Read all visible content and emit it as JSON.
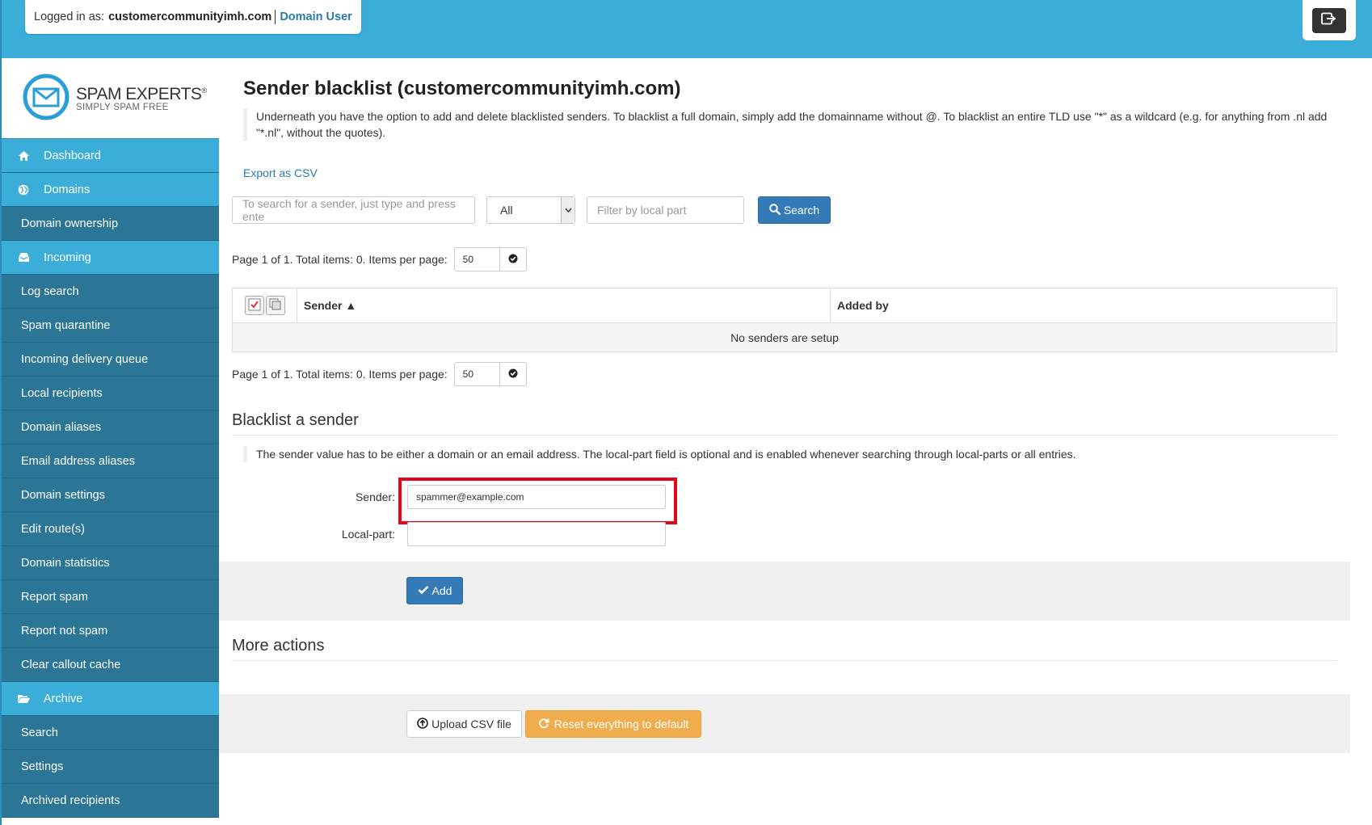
{
  "header": {
    "logged_in_label": "Logged in as:",
    "domain": "customercommunityimh.com",
    "role": "Domain User",
    "logout_icon": "logout-icon"
  },
  "brand": {
    "name": "SPAM EXPERTS",
    "registered": "®",
    "tagline": "SIMPLY SPAM FREE"
  },
  "sidebar": {
    "items": [
      {
        "label": "Dashboard",
        "type": "main",
        "icon": "home-icon"
      },
      {
        "label": "Domains",
        "type": "main",
        "icon": "globe-icon"
      },
      {
        "label": "Domain ownership",
        "type": "sub"
      },
      {
        "label": "Incoming",
        "type": "main",
        "icon": "inbox-icon"
      },
      {
        "label": "Log search",
        "type": "sub"
      },
      {
        "label": "Spam quarantine",
        "type": "sub"
      },
      {
        "label": "Incoming delivery queue",
        "type": "sub"
      },
      {
        "label": "Local recipients",
        "type": "sub"
      },
      {
        "label": "Domain aliases",
        "type": "sub"
      },
      {
        "label": "Email address aliases",
        "type": "sub"
      },
      {
        "label": "Domain settings",
        "type": "sub"
      },
      {
        "label": "Edit route(s)",
        "type": "sub"
      },
      {
        "label": "Domain statistics",
        "type": "sub"
      },
      {
        "label": "Report spam",
        "type": "sub"
      },
      {
        "label": "Report not spam",
        "type": "sub"
      },
      {
        "label": "Clear callout cache",
        "type": "sub"
      },
      {
        "label": "Archive",
        "type": "main",
        "icon": "folder-open-icon"
      },
      {
        "label": "Search",
        "type": "sub"
      },
      {
        "label": "Settings",
        "type": "sub"
      },
      {
        "label": "Archived recipients",
        "type": "sub"
      }
    ]
  },
  "main": {
    "title": "Sender blacklist (customercommunityimh.com)",
    "description": "Underneath you have the option to add and delete blacklisted senders. To blacklist a full domain, simply add the domainname without @. To blacklist an entire TLD use \"*\" as a wildcard (e.g. for anything from .nl add \"*.nl\", without the quotes).",
    "export_link": "Export as CSV",
    "search": {
      "placeholder": "To search for a sender, just type and press ente",
      "filter_select_value": "All",
      "local_part_placeholder": "Filter by local part",
      "search_button": "Search"
    },
    "pager": {
      "text": "Page 1 of 1. Total items: 0. Items per page:",
      "per_page": "50"
    },
    "table": {
      "columns": [
        "Sender ▲",
        "Added by"
      ],
      "empty_message": "No senders are setup"
    },
    "blacklist_form": {
      "title": "Blacklist a sender",
      "note": "The sender value has to be either a domain or an email address.  The local-part field is optional and is enabled whenever searching through local-parts or all entries.",
      "sender_label": "Sender:",
      "sender_value": "spammer@example.com",
      "local_part_label": "Local-part:",
      "local_part_value": "",
      "add_button": "Add"
    },
    "more_actions": {
      "title": "More actions",
      "upload_button": "Upload CSV file",
      "reset_button": "Reset everything to default"
    }
  },
  "colors": {
    "header_blue": "#3aaed9",
    "nav_sub": "#2b7696",
    "primary": "#337ab7",
    "warning": "#f0ad4e",
    "highlight": "#e3061a"
  }
}
